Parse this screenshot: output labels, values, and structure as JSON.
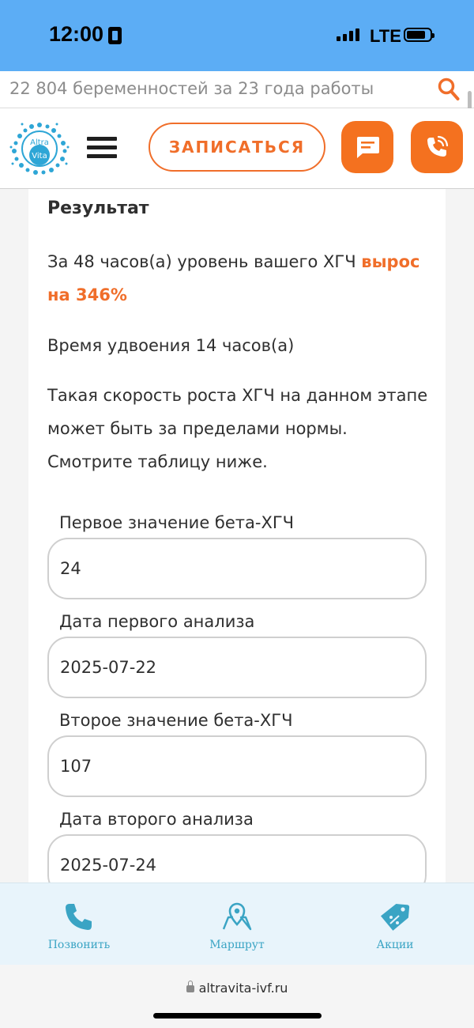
{
  "status_bar": {
    "time": "12:00",
    "network": "LTE"
  },
  "top_banner": {
    "text": "22 804 беременностей за 23 года работы"
  },
  "header": {
    "logo_text_top": "Altra",
    "logo_text_bottom": "Vita",
    "book_button": "ЗАПИСАТЬСЯ",
    "icons": [
      "search-icon",
      "menu-icon",
      "chat-icon",
      "phone-call-icon"
    ],
    "accent_color": "#f4711f"
  },
  "result": {
    "title": "Результат",
    "growth_prefix": "За 48 часов(а) уровень вашего ХГЧ ",
    "growth_highlight": "вырос на 346%",
    "doubling": "Время удвоения 14 часов(а)",
    "note": "Такая скорость роста ХГЧ на данном этапе может быть за пределами нормы. Смотрите таблицу ниже."
  },
  "fields": [
    {
      "label": "Первое значение бета-ХГЧ",
      "value": "24"
    },
    {
      "label": "Дата первого анализа",
      "value": "2025-07-22"
    },
    {
      "label": "Второе значение бета-ХГЧ",
      "value": "107"
    },
    {
      "label": "Дата второго анализа",
      "value": "2025-07-24"
    }
  ],
  "bottom_nav": [
    {
      "label": "Позвонить",
      "icon": "phone-icon"
    },
    {
      "label": "Маршрут",
      "icon": "map-pin-icon"
    },
    {
      "label": "Акции",
      "icon": "discount-tag-icon"
    }
  ],
  "browser": {
    "url": "altravita-ivf.ru"
  }
}
